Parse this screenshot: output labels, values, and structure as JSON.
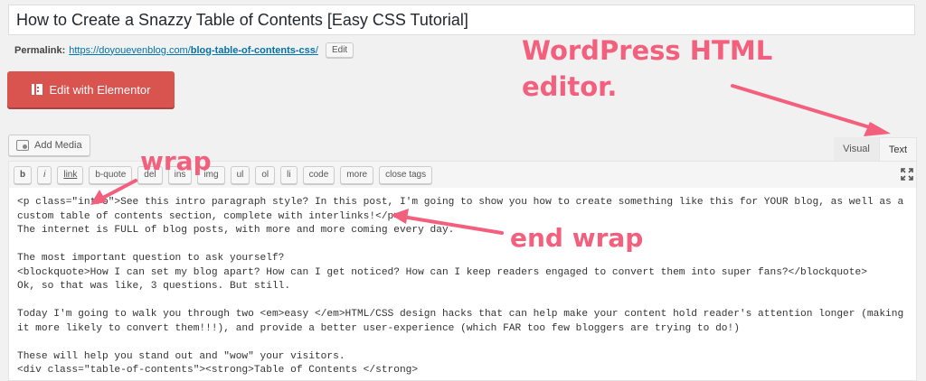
{
  "post": {
    "title": "How to Create a Snazzy Table of Contents [Easy CSS Tutorial]",
    "permalink_label": "Permalink:",
    "permalink_base": "https://doyouevenblog.com/",
    "permalink_slug": "blog-table-of-contents-css",
    "permalink_trail": "/",
    "edit_label": "Edit"
  },
  "elementor": {
    "label": "Edit with Elementor",
    "icon": "elementor-icon"
  },
  "media": {
    "label": "Add Media",
    "icon": "add-media-icon"
  },
  "tabs": {
    "visual": "Visual",
    "text": "Text"
  },
  "toolbar": {
    "buttons": [
      "b",
      "i",
      "link",
      "b-quote",
      "del",
      "ins",
      "img",
      "ul",
      "ol",
      "li",
      "code",
      "more",
      "close tags"
    ],
    "fullscreen_icon": "fullscreen-icon"
  },
  "editor": {
    "lines": [
      "<p class=\"intro\">See this intro paragraph style? In this post, I'm going to show you how to create something like this for YOUR blog, as well as a",
      "custom table of contents section, complete with interlinks!</p>",
      "The internet is FULL of blog posts, with more and more coming every day.",
      "",
      "The most important question to ask yourself?",
      "<blockquote>How I can set my blog apart? How can I get noticed? How can I keep readers engaged to convert them into super fans?</blockquote>",
      "Ok, so that was like, 3 questions. But still.",
      "",
      "Today I'm going to walk you through two <em>easy </em>HTML/CSS design hacks that can help make your content hold reader's attention longer (making",
      "it more likely to convert them!!!), and provide a better user-experience (which FAR too few bloggers are trying to do!)",
      "",
      "These will help you stand out and \"wow\" your visitors.",
      "<div class=\"table-of-contents\"><strong>Table of Contents </strong>"
    ]
  },
  "annotations": {
    "wp_line1": "WordPress HTML",
    "wp_line2": "editor.",
    "wrap": "wrap",
    "end_wrap": "end wrap",
    "color": "#f2607d"
  },
  "colors": {
    "elementor": "#d9534f",
    "link": "#0073aa",
    "background": "#f1f1f1"
  }
}
